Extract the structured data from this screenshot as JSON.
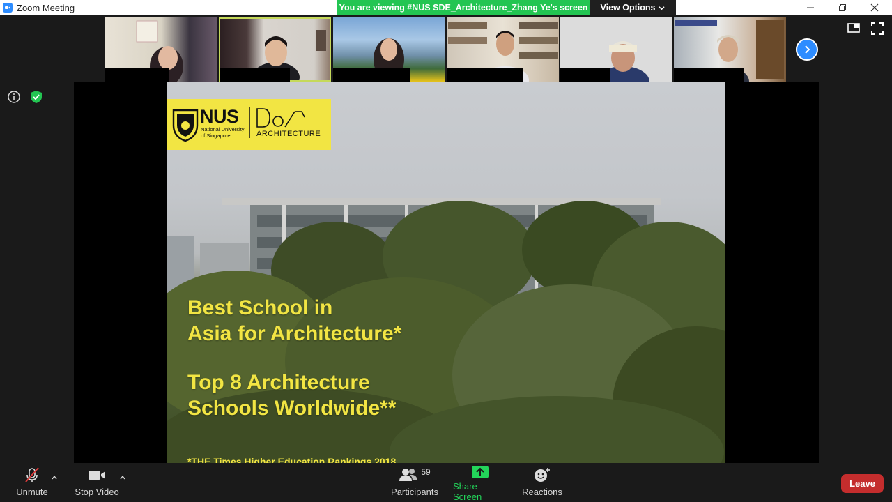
{
  "window": {
    "title": "Zoom Meeting"
  },
  "banner": {
    "text": "You are viewing #NUS SDE_Architecture_Zhang Ye's screen",
    "view_options": "View Options"
  },
  "participants_strip": [
    {
      "name_hidden": true
    },
    {
      "name_hidden": true,
      "active_speaker": true
    },
    {
      "name_hidden": true
    },
    {
      "name_hidden": true
    },
    {
      "name_hidden": true
    },
    {
      "name_hidden": true
    }
  ],
  "slide": {
    "logo_nus": "NUS",
    "logo_sub1": "National University",
    "logo_sub2": "of Singapore",
    "logo_doa": "ARCHITECTURE",
    "line1": "Best School in",
    "line2": "Asia for Architecture*",
    "line3": "Top 8 Architecture",
    "line4": "Schools Worldwide**",
    "footnote": "*THE Times Higher Education Rankings 2018"
  },
  "toolbar": {
    "unmute": "Unmute",
    "stop_video": "Stop Video",
    "participants": "Participants",
    "participant_count": "59",
    "share_screen": "Share Screen",
    "reactions": "Reactions",
    "leave": "Leave"
  },
  "colors": {
    "zoom_blue": "#2d8cff",
    "banner_green": "#23c552",
    "leave_red": "#c42d2d",
    "slide_yellow": "#f2e543"
  }
}
